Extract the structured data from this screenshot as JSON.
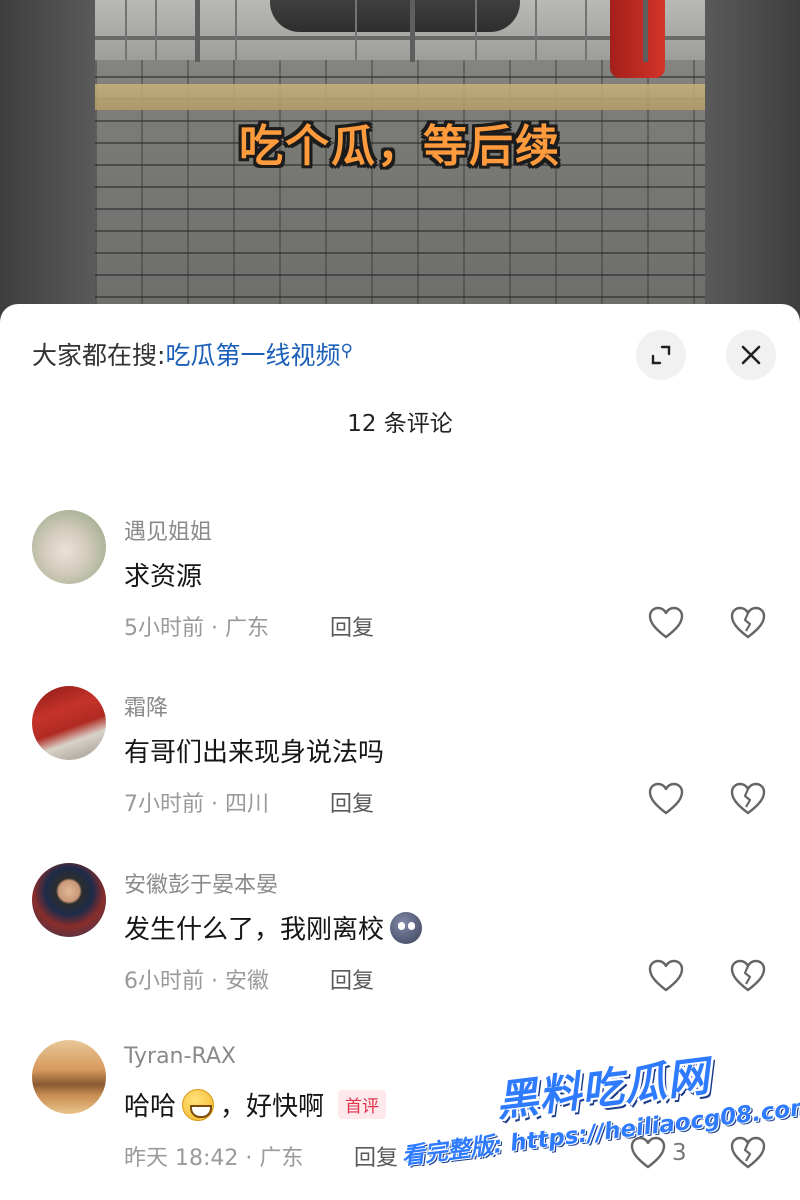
{
  "video": {
    "overlay_text": "吃个瓜，等后续"
  },
  "sheet": {
    "search_prefix": "大家都在搜:",
    "search_keyword": "吃瓜第一线视频",
    "comment_count": "12 条评论"
  },
  "comments": [
    {
      "name": "遇见姐姐",
      "text": "求资源",
      "emoji": "",
      "badge": "",
      "meta": "5小时前 · 广东",
      "reply": "回复",
      "likes": ""
    },
    {
      "name": "霜降",
      "text": "有哥们出来现身说法吗",
      "emoji": "",
      "badge": "",
      "meta": "7小时前 · 四川",
      "reply": "回复",
      "likes": ""
    },
    {
      "name": "安徽彭于晏本晏",
      "text": "发生什么了，我刚离校",
      "emoji": "blob",
      "badge": "",
      "meta": "6小时前 · 安徽",
      "reply": "回复",
      "likes": ""
    },
    {
      "name": "Tyran-RAX",
      "text": "哈哈",
      "text_after": "，好快啊",
      "emoji": "grin",
      "badge": "首评",
      "meta": "昨天 18:42 · 广东",
      "reply": "回复",
      "likes": "3"
    }
  ],
  "watermark": {
    "title": "黑料吃瓜网",
    "url": "看完整版: https://heiliaocg08.com"
  },
  "colors": {
    "keyword": "#1b5fb8",
    "overlay_text": "#ff9b3d",
    "badge": "#e0344e",
    "watermark": "#2e7bff"
  }
}
